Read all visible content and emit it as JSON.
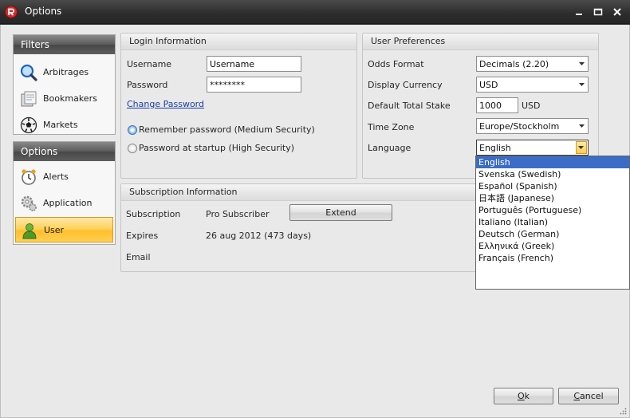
{
  "window": {
    "title": "Options"
  },
  "nav": {
    "filters": {
      "header": "Filters",
      "items": [
        {
          "label": "Arbitrages",
          "icon": "magnifier-icon"
        },
        {
          "label": "Bookmakers",
          "icon": "bookmakers-icon"
        },
        {
          "label": "Markets",
          "icon": "soccer-ball-icon"
        }
      ]
    },
    "options": {
      "header": "Options",
      "items": [
        {
          "label": "Alerts",
          "icon": "alarm-clock-icon"
        },
        {
          "label": "Application",
          "icon": "gears-icon"
        },
        {
          "label": "User",
          "icon": "user-icon",
          "active": true
        }
      ]
    }
  },
  "login": {
    "title": "Login Information",
    "username_label": "Username",
    "username_value": "Username",
    "password_label": "Password",
    "password_value": "********",
    "change_password": "Change Password",
    "remember_option": "Remember password (Medium Security)",
    "startup_option": "Password at startup (High Security)",
    "selected_option": "remember"
  },
  "prefs": {
    "title": "User Preferences",
    "odds_format_label": "Odds Format",
    "odds_format_value": "Decimals (2.20)",
    "currency_label": "Display Currency",
    "currency_value": "USD",
    "stake_label": "Default Total Stake",
    "stake_value": "1000",
    "stake_unit": "USD",
    "timezone_label": "Time Zone",
    "timezone_value": "Europe/Stockholm",
    "language_label": "Language",
    "language_value": "English",
    "language_options": [
      "English",
      "Svenska (Swedish)",
      "Español (Spanish)",
      "日本語 (Japanese)",
      "Português (Portuguese)",
      "Italiano (Italian)",
      "Deutsch (German)",
      "Ελληνικά (Greek)",
      "Français (French)"
    ]
  },
  "subscription": {
    "title": "Subscription Information",
    "subscription_label": "Subscription",
    "subscription_value": "Pro Subscriber",
    "extend_button": "Extend",
    "expires_label": "Expires",
    "expires_value": "26 aug 2012 (473 days)",
    "email_label": "Email"
  },
  "footer": {
    "ok_first": "O",
    "ok_rest": "k",
    "cancel_first": "C",
    "cancel_rest": "ancel"
  },
  "colors": {
    "accent": "#ffc53a",
    "selection": "#3b6cc6",
    "link": "#1b3ea8"
  }
}
